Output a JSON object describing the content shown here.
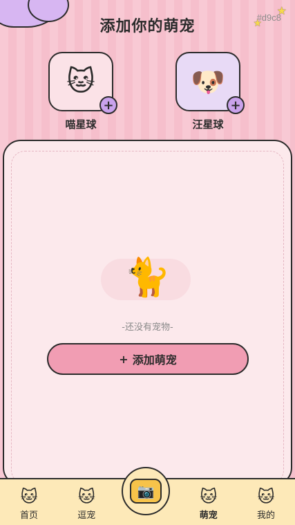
{
  "header": {
    "title": "添加你的萌宠",
    "watermark": "#d9c8"
  },
  "species": [
    {
      "label": "喵星球",
      "icon": "cat-icon",
      "glyph": "🐱",
      "plus": "+"
    },
    {
      "label": "汪星球",
      "icon": "dog-icon",
      "glyph": "🐶",
      "plus": "+"
    }
  ],
  "empty_state": {
    "glyph": "🐈",
    "text": "-还没有宠物-"
  },
  "add_button": {
    "icon": "+",
    "label": "添加萌宠"
  },
  "tabbar": {
    "items": [
      {
        "label": "首页",
        "glyph": "🐱",
        "active": false
      },
      {
        "label": "逗宠",
        "glyph": "🐱",
        "active": false
      },
      {
        "label": "萌宠",
        "glyph": "🐱",
        "active": true
      },
      {
        "label": "我的",
        "glyph": "🐱",
        "active": false
      }
    ],
    "camera_glyph": "📷"
  },
  "colors": {
    "background": "#f8c9d4",
    "accent_button": "#f19db3",
    "tabbar": "#fde9b8",
    "badge": "#c9a2ec"
  }
}
